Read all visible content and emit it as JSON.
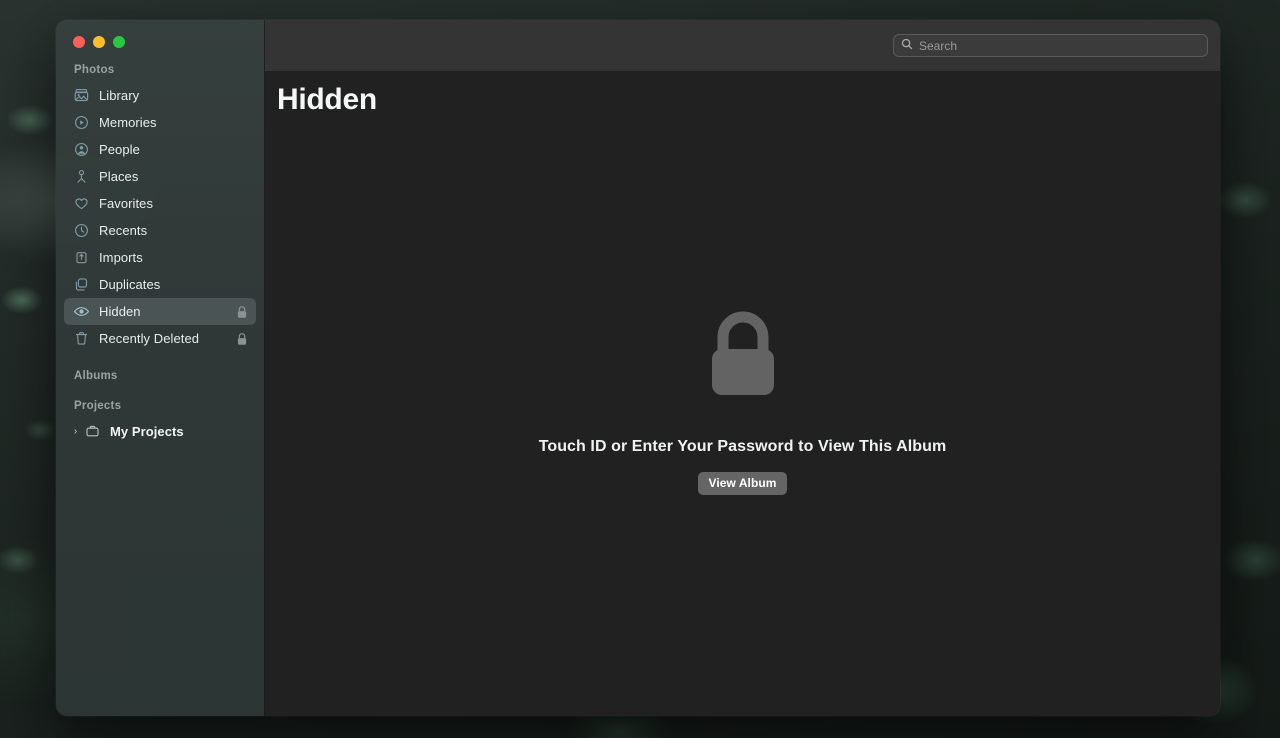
{
  "window": {
    "traffic_lights": [
      {
        "name": "close",
        "color": "#ff5f57"
      },
      {
        "name": "minimize",
        "color": "#febc2e"
      },
      {
        "name": "zoom",
        "color": "#28c840"
      }
    ]
  },
  "search": {
    "placeholder": "Search",
    "value": "",
    "icon": "search-icon"
  },
  "sidebar": {
    "sections": [
      {
        "header": "Photos",
        "items": [
          {
            "label": "Library",
            "icon": "photo-library-icon",
            "selected": false,
            "locked": false
          },
          {
            "label": "Memories",
            "icon": "memories-play-icon",
            "selected": false,
            "locked": false
          },
          {
            "label": "People",
            "icon": "person-circle-icon",
            "selected": false,
            "locked": false
          },
          {
            "label": "Places",
            "icon": "map-pin-icon",
            "selected": false,
            "locked": false
          },
          {
            "label": "Favorites",
            "icon": "heart-icon",
            "selected": false,
            "locked": false
          },
          {
            "label": "Recents",
            "icon": "clock-icon",
            "selected": false,
            "locked": false
          },
          {
            "label": "Imports",
            "icon": "import-tray-icon",
            "selected": false,
            "locked": false
          },
          {
            "label": "Duplicates",
            "icon": "duplicates-icon",
            "selected": false,
            "locked": false
          },
          {
            "label": "Hidden",
            "icon": "eye-icon",
            "selected": true,
            "locked": true
          },
          {
            "label": "Recently Deleted",
            "icon": "trash-icon",
            "selected": false,
            "locked": true
          }
        ]
      },
      {
        "header": "Albums",
        "items": []
      },
      {
        "header": "Projects",
        "items": [
          {
            "label": "My Projects",
            "icon": "projects-folder-icon",
            "selected": false,
            "locked": false,
            "disclosure": "›",
            "bold": true
          }
        ]
      }
    ]
  },
  "main": {
    "title": "Hidden",
    "empty_state": {
      "icon": "lock-closed-icon",
      "message": "Touch ID or Enter Your Password to View This Album",
      "button_label": "View Album"
    }
  },
  "colors": {
    "sidebar_bg": "#36403e",
    "content_bg": "#212121",
    "toolbar_bg": "#343434",
    "selected_row": "#4b5455",
    "icon_tint": "#7f9aa5",
    "button_bg": "#656565",
    "lock_gray": "#5b5b5b"
  }
}
